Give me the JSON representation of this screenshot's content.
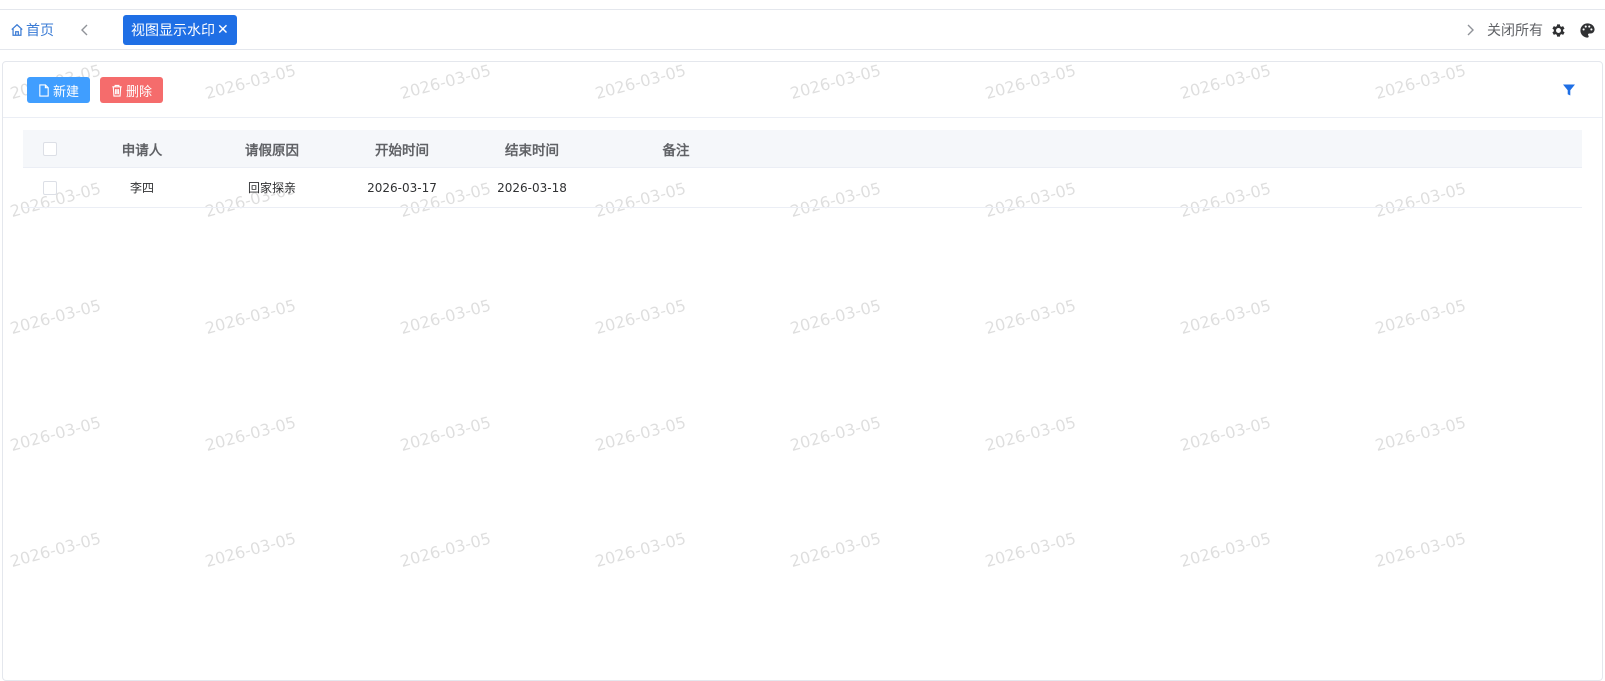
{
  "tabbar": {
    "home_label": "首页",
    "active_tab_label": "视图显示水印",
    "tab_close_glyph": "✕",
    "close_all_label": "关闭所有"
  },
  "toolbar": {
    "new_label": "新建",
    "delete_label": "删除"
  },
  "table": {
    "columns": [
      "申请人",
      "请假原因",
      "开始时间",
      "结束时间",
      "备注"
    ],
    "rows": [
      {
        "applicant": "李四",
        "reason": "回家探亲",
        "start": "2026-03-17",
        "end": "2026-03-18",
        "note": ""
      }
    ]
  },
  "watermark": {
    "text": "2026-03-05"
  },
  "colors": {
    "accent": "#1f6fe5",
    "new_button": "#409eff",
    "delete_button": "#f56c6c"
  },
  "icons": {
    "home": "home-icon",
    "prev": "chevron-left-icon",
    "next": "chevron-right-icon",
    "settings": "gear-icon",
    "theme": "palette-icon",
    "new": "file-icon",
    "delete": "trash-icon",
    "filter": "filter-icon"
  }
}
